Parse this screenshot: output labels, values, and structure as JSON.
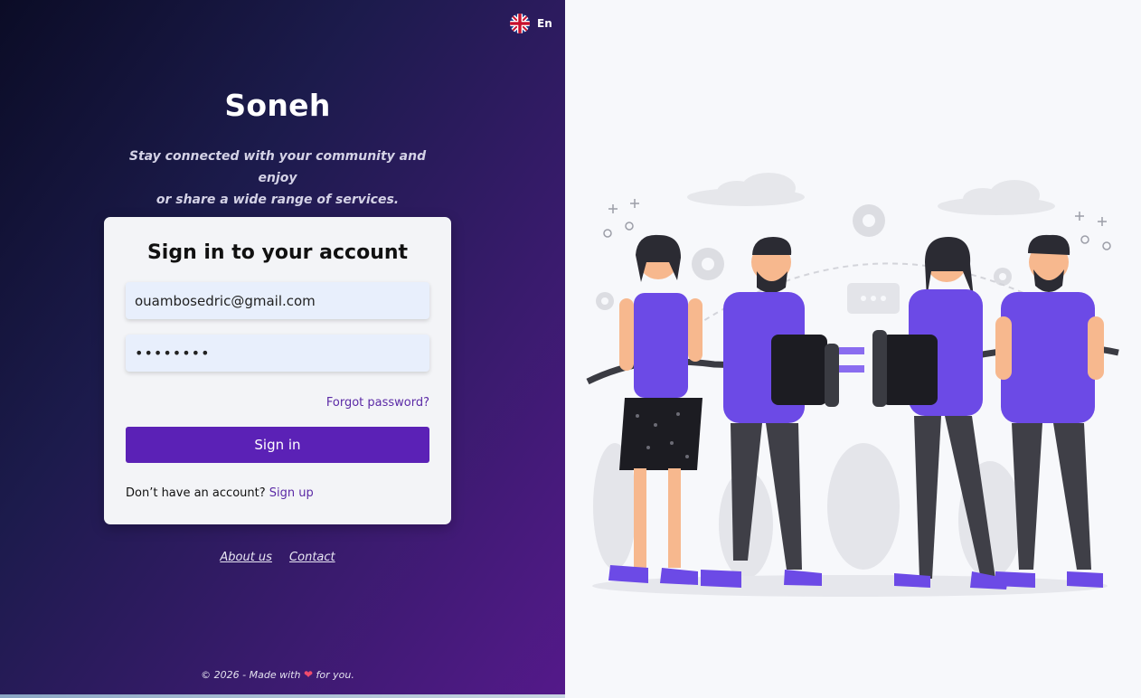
{
  "language": {
    "label": "En",
    "flag_icon": "uk-flag-icon"
  },
  "brand": {
    "title": "Soneh",
    "tagline_line1": "Stay connected with your community and enjoy",
    "tagline_line2": "or share a wide range of services."
  },
  "login": {
    "heading": "Sign in to your account",
    "email_value": "ouambosedric@gmail.com",
    "password_value": "••••••••",
    "forgot_label": "Forgot password?",
    "submit_label": "Sign in",
    "signup_prompt": "Don’t have an account?",
    "signup_link": "Sign up"
  },
  "footer": {
    "about_label": "About us",
    "contact_label": "Contact",
    "copyright_prefix": "© 2026 - Made with",
    "copyright_suffix": "for you.",
    "heart_icon": "heart-icon"
  },
  "colors": {
    "accent": "#5b21b6",
    "link": "#5b2aa6",
    "illustration_purple": "#6c4ae6"
  },
  "illustration": {
    "icon": "people-connecting-plugs-illustration"
  }
}
